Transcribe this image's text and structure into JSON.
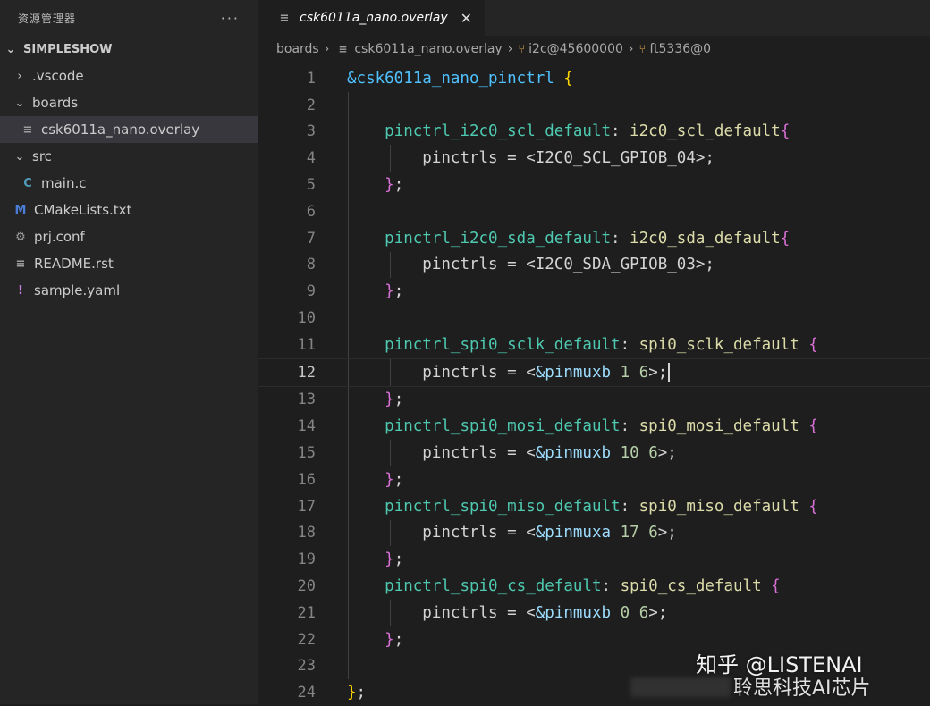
{
  "sidebar": {
    "title": "资源管理器",
    "more": "···",
    "section": "SIMPLESHOW",
    "items": [
      {
        "label": ".vscode",
        "chev": "›",
        "icon": "",
        "kind": "folder-closed"
      },
      {
        "label": "boards",
        "chev": "⌄",
        "icon": "",
        "kind": "folder-open"
      },
      {
        "label": "csk6011a_nano.overlay",
        "chev": "",
        "icon": "≡",
        "kind": "file-overlay"
      },
      {
        "label": "src",
        "chev": "⌄",
        "icon": "",
        "kind": "folder-open"
      },
      {
        "label": "main.c",
        "chev": "",
        "icon": "C",
        "kind": "file-c"
      },
      {
        "label": "CMakeLists.txt",
        "chev": "",
        "icon": "M",
        "kind": "file-cmake"
      },
      {
        "label": "prj.conf",
        "chev": "",
        "icon": "⚙",
        "kind": "file-conf"
      },
      {
        "label": "README.rst",
        "chev": "",
        "icon": "≡",
        "kind": "file-rst"
      },
      {
        "label": "sample.yaml",
        "chev": "",
        "icon": "!",
        "kind": "file-yaml"
      }
    ]
  },
  "editor": {
    "tab": {
      "label": "csk6011a_nano.overlay",
      "icon": "≡",
      "close": "✕"
    },
    "breadcrumb": [
      "boards",
      "csk6011a_nano.overlay",
      "i2c@45600000",
      "ft5336@0"
    ],
    "current_line": 12,
    "lines": [
      {
        "n": "1",
        "tokens": [
          [
            "t-amp",
            "&csk6011a_nano_pinctrl"
          ],
          [
            "t-op",
            " "
          ],
          [
            "t-brace-y",
            "{"
          ]
        ]
      },
      {
        "n": "2",
        "tokens": []
      },
      {
        "n": "3",
        "tokens": [
          [
            "t-op",
            "    "
          ],
          [
            "t-label",
            "pinctrl_i2c0_scl_default"
          ],
          [
            "t-op",
            ": "
          ],
          [
            "t-node",
            "i2c0_scl_default"
          ],
          [
            "t-brace-p",
            "{"
          ]
        ]
      },
      {
        "n": "4",
        "tokens": [
          [
            "t-op",
            "        "
          ],
          [
            "t-prop",
            "pinctrls"
          ],
          [
            "t-op",
            " = <"
          ],
          [
            "t-macro",
            "I2C0_SCL_GPIOB_04"
          ],
          [
            "t-op",
            ">;"
          ]
        ]
      },
      {
        "n": "5",
        "tokens": [
          [
            "t-op",
            "    "
          ],
          [
            "t-brace-p",
            "}"
          ],
          [
            "t-op",
            ";"
          ]
        ]
      },
      {
        "n": "6",
        "tokens": []
      },
      {
        "n": "7",
        "tokens": [
          [
            "t-op",
            "    "
          ],
          [
            "t-label",
            "pinctrl_i2c0_sda_default"
          ],
          [
            "t-op",
            ": "
          ],
          [
            "t-node",
            "i2c0_sda_default"
          ],
          [
            "t-brace-p",
            "{"
          ]
        ]
      },
      {
        "n": "8",
        "tokens": [
          [
            "t-op",
            "        "
          ],
          [
            "t-prop",
            "pinctrls"
          ],
          [
            "t-op",
            " = <"
          ],
          [
            "t-macro",
            "I2C0_SDA_GPIOB_03"
          ],
          [
            "t-op",
            ">;"
          ]
        ]
      },
      {
        "n": "9",
        "tokens": [
          [
            "t-op",
            "    "
          ],
          [
            "t-brace-p",
            "}"
          ],
          [
            "t-op",
            ";"
          ]
        ]
      },
      {
        "n": "10",
        "tokens": []
      },
      {
        "n": "11",
        "tokens": [
          [
            "t-op",
            "    "
          ],
          [
            "t-label",
            "pinctrl_spi0_sclk_default"
          ],
          [
            "t-op",
            ": "
          ],
          [
            "t-node",
            "spi0_sclk_default"
          ],
          [
            "t-op",
            " "
          ],
          [
            "t-brace-p",
            "{"
          ]
        ]
      },
      {
        "n": "12",
        "tokens": [
          [
            "t-op",
            "        "
          ],
          [
            "t-prop",
            "pinctrls"
          ],
          [
            "t-op",
            " = <"
          ],
          [
            "t-ref",
            "&pinmuxb"
          ],
          [
            "t-op",
            " "
          ],
          [
            "t-num",
            "1"
          ],
          [
            "t-op",
            " "
          ],
          [
            "t-num",
            "6"
          ],
          [
            "t-op",
            ">;"
          ]
        ],
        "cursor": true
      },
      {
        "n": "13",
        "tokens": [
          [
            "t-op",
            "    "
          ],
          [
            "t-brace-p",
            "}"
          ],
          [
            "t-op",
            ";"
          ]
        ]
      },
      {
        "n": "14",
        "tokens": [
          [
            "t-op",
            "    "
          ],
          [
            "t-label",
            "pinctrl_spi0_mosi_default"
          ],
          [
            "t-op",
            ": "
          ],
          [
            "t-node",
            "spi0_mosi_default"
          ],
          [
            "t-op",
            " "
          ],
          [
            "t-brace-p",
            "{"
          ]
        ]
      },
      {
        "n": "15",
        "tokens": [
          [
            "t-op",
            "        "
          ],
          [
            "t-prop",
            "pinctrls"
          ],
          [
            "t-op",
            " = <"
          ],
          [
            "t-ref",
            "&pinmuxb"
          ],
          [
            "t-op",
            " "
          ],
          [
            "t-num",
            "10"
          ],
          [
            "t-op",
            " "
          ],
          [
            "t-num",
            "6"
          ],
          [
            "t-op",
            ">;"
          ]
        ]
      },
      {
        "n": "16",
        "tokens": [
          [
            "t-op",
            "    "
          ],
          [
            "t-brace-p",
            "}"
          ],
          [
            "t-op",
            ";"
          ]
        ]
      },
      {
        "n": "17",
        "tokens": [
          [
            "t-op",
            "    "
          ],
          [
            "t-label",
            "pinctrl_spi0_miso_default"
          ],
          [
            "t-op",
            ": "
          ],
          [
            "t-node",
            "spi0_miso_default"
          ],
          [
            "t-op",
            " "
          ],
          [
            "t-brace-p",
            "{"
          ]
        ]
      },
      {
        "n": "18",
        "tokens": [
          [
            "t-op",
            "        "
          ],
          [
            "t-prop",
            "pinctrls"
          ],
          [
            "t-op",
            " = <"
          ],
          [
            "t-ref",
            "&pinmuxa"
          ],
          [
            "t-op",
            " "
          ],
          [
            "t-num",
            "17"
          ],
          [
            "t-op",
            " "
          ],
          [
            "t-num",
            "6"
          ],
          [
            "t-op",
            ">;"
          ]
        ]
      },
      {
        "n": "19",
        "tokens": [
          [
            "t-op",
            "    "
          ],
          [
            "t-brace-p",
            "}"
          ],
          [
            "t-op",
            ";"
          ]
        ]
      },
      {
        "n": "20",
        "tokens": [
          [
            "t-op",
            "    "
          ],
          [
            "t-label",
            "pinctrl_spi0_cs_default"
          ],
          [
            "t-op",
            ": "
          ],
          [
            "t-node",
            "spi0_cs_default"
          ],
          [
            "t-op",
            " "
          ],
          [
            "t-brace-p",
            "{"
          ]
        ]
      },
      {
        "n": "21",
        "tokens": [
          [
            "t-op",
            "        "
          ],
          [
            "t-prop",
            "pinctrls"
          ],
          [
            "t-op",
            " = <"
          ],
          [
            "t-ref",
            "&pinmuxb"
          ],
          [
            "t-op",
            " "
          ],
          [
            "t-num",
            "0"
          ],
          [
            "t-op",
            " "
          ],
          [
            "t-num",
            "6"
          ],
          [
            "t-op",
            ">;"
          ]
        ]
      },
      {
        "n": "22",
        "tokens": [
          [
            "t-op",
            "    "
          ],
          [
            "t-brace-p",
            "}"
          ],
          [
            "t-op",
            ";"
          ]
        ]
      },
      {
        "n": "23",
        "tokens": []
      },
      {
        "n": "24",
        "tokens": [
          [
            "t-brace-y",
            "}"
          ],
          [
            "t-op",
            ";"
          ]
        ]
      }
    ]
  },
  "watermark": {
    "line1": "知乎 @LISTENAI",
    "line2": "聆思科技AI芯片"
  }
}
